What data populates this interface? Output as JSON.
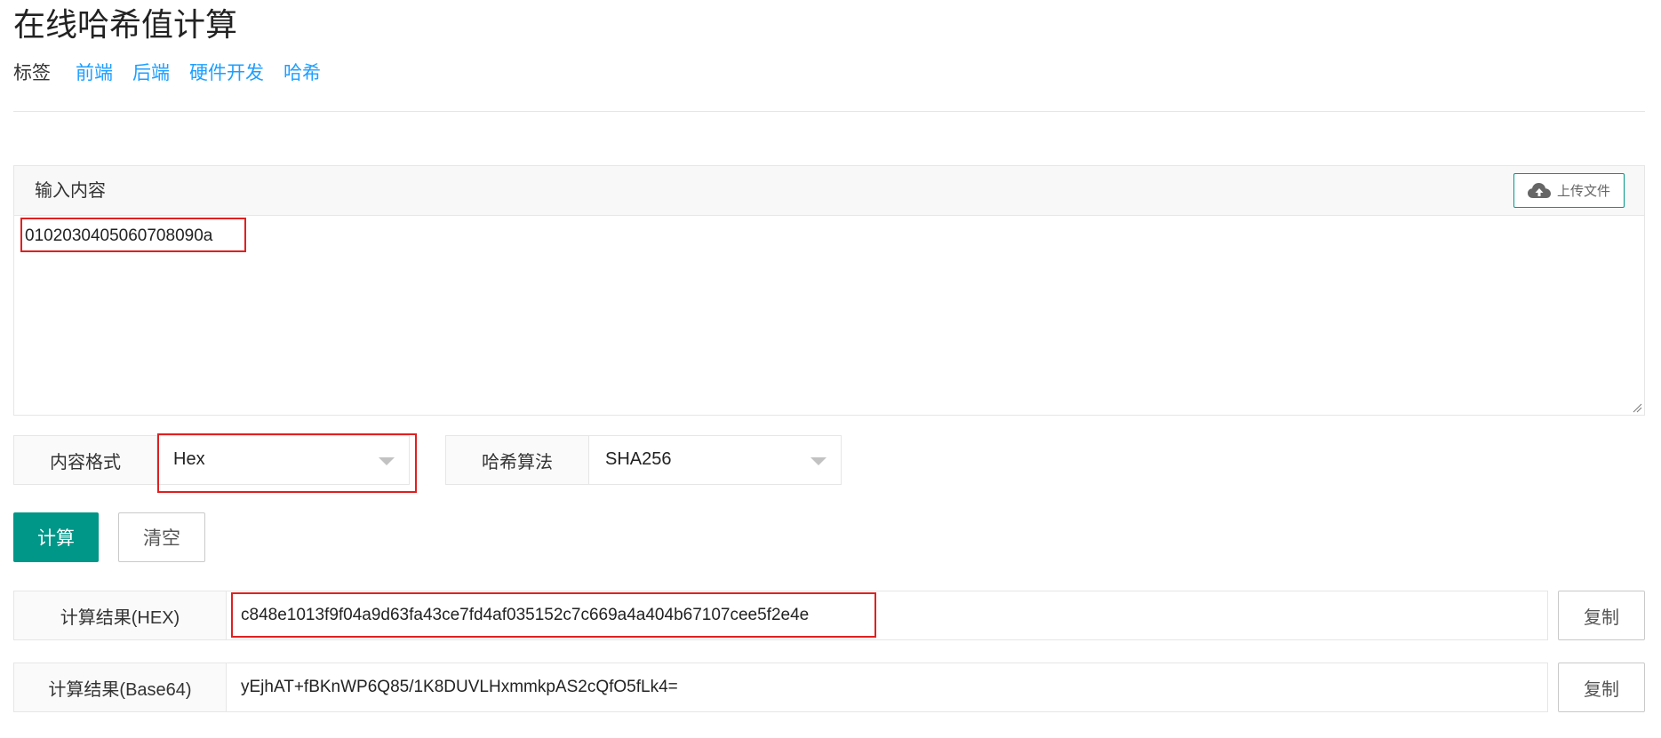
{
  "page": {
    "title": "在线哈希值计算"
  },
  "tags": {
    "label": "标签",
    "links": [
      "前端",
      "后端",
      "硬件开发",
      "哈希"
    ]
  },
  "input_panel": {
    "title": "输入内容",
    "upload_label": "上传文件",
    "upload_icon": "cloud-upload-icon",
    "value": "0102030405060708090a"
  },
  "content_format": {
    "label": "内容格式",
    "selected": "Hex"
  },
  "hash_algorithm": {
    "label": "哈希算法",
    "selected": "SHA256"
  },
  "actions": {
    "compute_label": "计算",
    "clear_label": "清空"
  },
  "results": {
    "hex": {
      "label": "计算结果(HEX)",
      "value": "c848e1013f9f04a9d63fa43ce7fd4af035152c7c669a4a404b67107cee5f2e4e",
      "copy_label": "复制"
    },
    "base64": {
      "label": "计算结果(Base64)",
      "value": "yEjhAT+fBKnWP6Q85/1K8DUVLHxmmkpAS2cQfO5fLk4=",
      "copy_label": "复制"
    }
  },
  "colors": {
    "primary": "#009688",
    "link": "#1e9fff",
    "highlight": "#e02020"
  }
}
